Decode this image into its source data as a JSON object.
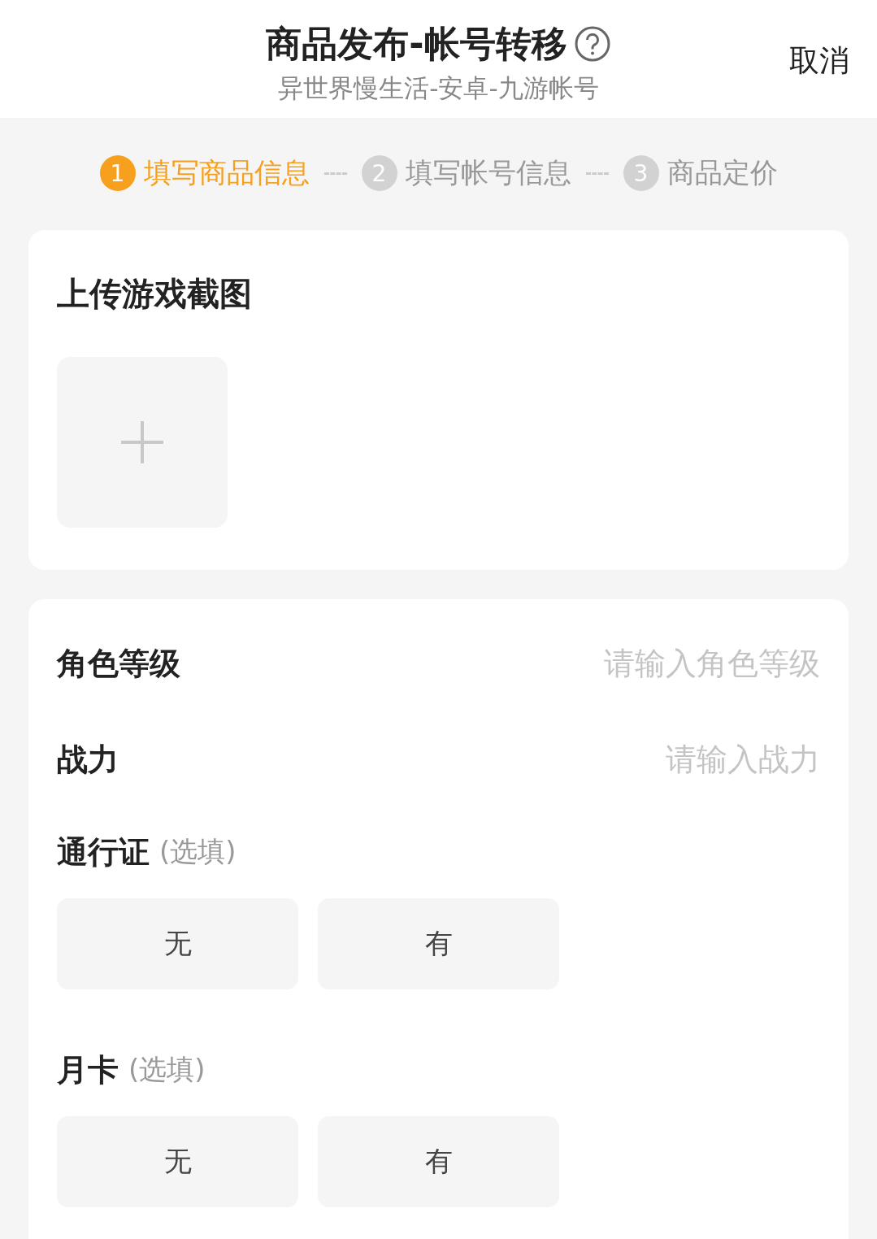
{
  "header": {
    "title": "商品发布-帐号转移",
    "subtitle": "异世界慢生活-安卓-九游帐号",
    "cancel": "取消"
  },
  "steps": [
    {
      "number": "1",
      "label": "填写商品信息",
      "selected": true
    },
    {
      "number": "2",
      "label": "填写帐号信息",
      "selected": false
    },
    {
      "number": "3",
      "label": "商品定价",
      "selected": false
    }
  ],
  "upload": {
    "title": "上传游戏截图"
  },
  "fields": [
    {
      "label": "角色等级",
      "placeholder": "请输入角色等级"
    },
    {
      "label": "战力",
      "placeholder": "请输入战力"
    }
  ],
  "choices": [
    {
      "label": "通行证",
      "hint": "(选填)",
      "options": [
        {
          "label": "无",
          "selected": false
        },
        {
          "label": "有",
          "selected": false
        }
      ]
    },
    {
      "label": "月卡",
      "hint": "(选填)",
      "options": [
        {
          "label": "无",
          "selected": false
        },
        {
          "label": "有",
          "selected": false
        }
      ]
    }
  ]
}
